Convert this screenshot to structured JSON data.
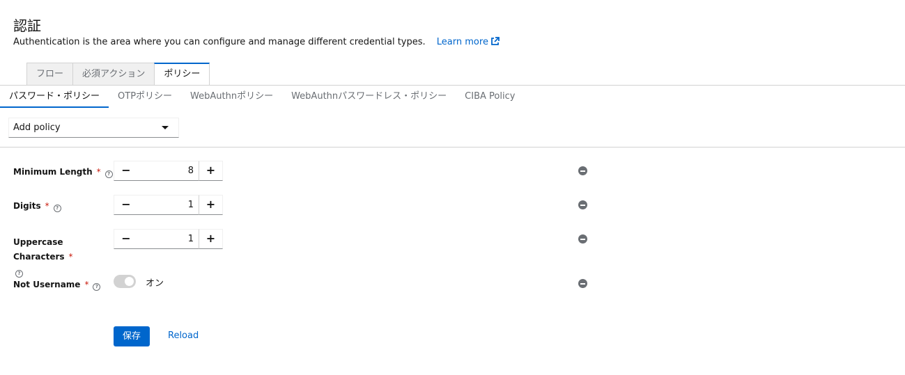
{
  "header": {
    "title": "認証",
    "description": "Authentication is the area where you can configure and manage different credential types.",
    "learn_more": "Learn more"
  },
  "main_tabs": [
    {
      "label": "フロー",
      "active": false
    },
    {
      "label": "必須アクション",
      "active": false
    },
    {
      "label": "ポリシー",
      "active": true
    }
  ],
  "sub_tabs": [
    {
      "label": "パスワード・ポリシー",
      "active": true
    },
    {
      "label": "OTPポリシー",
      "active": false
    },
    {
      "label": "WebAuthnポリシー",
      "active": false
    },
    {
      "label": "WebAuthnパスワードレス・ポリシー",
      "active": false
    },
    {
      "label": "CIBA Policy",
      "active": false
    }
  ],
  "add_policy": {
    "label": "Add policy"
  },
  "policies": [
    {
      "label": "Minimum Length",
      "required": "*",
      "value": "8"
    },
    {
      "label": "Digits",
      "required": "*",
      "value": "1"
    },
    {
      "label": "Uppercase Characters",
      "required": "*",
      "value": "1"
    },
    {
      "label": "Not Username",
      "required": "*",
      "toggle_label": "オン",
      "toggle_on": true
    }
  ],
  "stepper": {
    "minus": "−",
    "plus": "+"
  },
  "help_glyph": "?",
  "actions": {
    "save": "保存",
    "reload": "Reload"
  },
  "colors": {
    "accent": "#0066cc",
    "required": "#c9190b",
    "toggle_disabled": "#d2d2d2"
  }
}
